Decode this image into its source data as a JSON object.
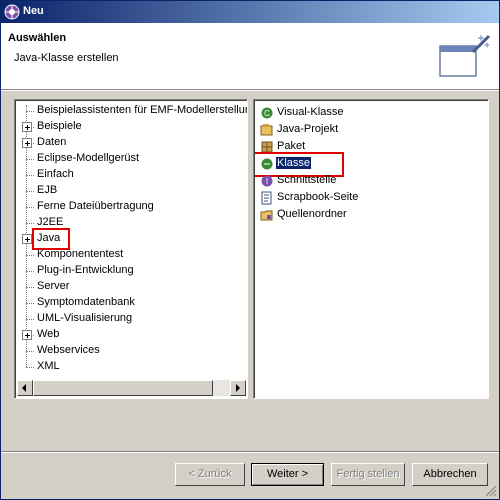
{
  "window": {
    "title": "Neu",
    "title_icon": "wizard-app-icon"
  },
  "header": {
    "title": "Auswählen",
    "description": "Java-Klasse erstellen",
    "icon": "new-class-wizard-icon"
  },
  "tree": {
    "items": [
      {
        "label": "Beispielassistenten für EMF-Modellerstellung",
        "expandable": false
      },
      {
        "label": "Beispiele",
        "expandable": true
      },
      {
        "label": "Daten",
        "expandable": true
      },
      {
        "label": "Eclipse-Modellgerüst",
        "expandable": false
      },
      {
        "label": "Einfach",
        "expandable": false
      },
      {
        "label": "EJB",
        "expandable": false
      },
      {
        "label": "Ferne Dateiübertragung",
        "expandable": false
      },
      {
        "label": "J2EE",
        "expandable": false
      },
      {
        "label": "Java",
        "expandable": true,
        "highlighted": true
      },
      {
        "label": "Komponententest",
        "expandable": false
      },
      {
        "label": "Plug-in-Entwicklung",
        "expandable": false
      },
      {
        "label": "Server",
        "expandable": false
      },
      {
        "label": "Symptomdatenbank",
        "expandable": false
      },
      {
        "label": "UML-Visualisierung",
        "expandable": false
      },
      {
        "label": "Web",
        "expandable": true
      },
      {
        "label": "Webservices",
        "expandable": false
      },
      {
        "label": "XML",
        "expandable": false
      }
    ]
  },
  "list": {
    "items": [
      {
        "label": "Visual-Klasse",
        "icon": "visual-class-icon"
      },
      {
        "label": "Java-Projekt",
        "icon": "java-project-icon"
      },
      {
        "label": "Paket",
        "icon": "package-icon"
      },
      {
        "label": "Klasse",
        "icon": "class-icon",
        "selected": true
      },
      {
        "label": "Schnittstelle",
        "icon": "interface-icon"
      },
      {
        "label": "Scrapbook-Seite",
        "icon": "scrapbook-icon"
      },
      {
        "label": "Quellenordner",
        "icon": "source-folder-icon"
      }
    ]
  },
  "buttons": {
    "back": "< Zurück",
    "next": "Weiter >",
    "finish": "Fertig stellen",
    "cancel": "Abbrechen"
  },
  "colors": {
    "highlight_box": "#e00000",
    "selection": "#0a246a",
    "titlebar": "#0a246a"
  }
}
